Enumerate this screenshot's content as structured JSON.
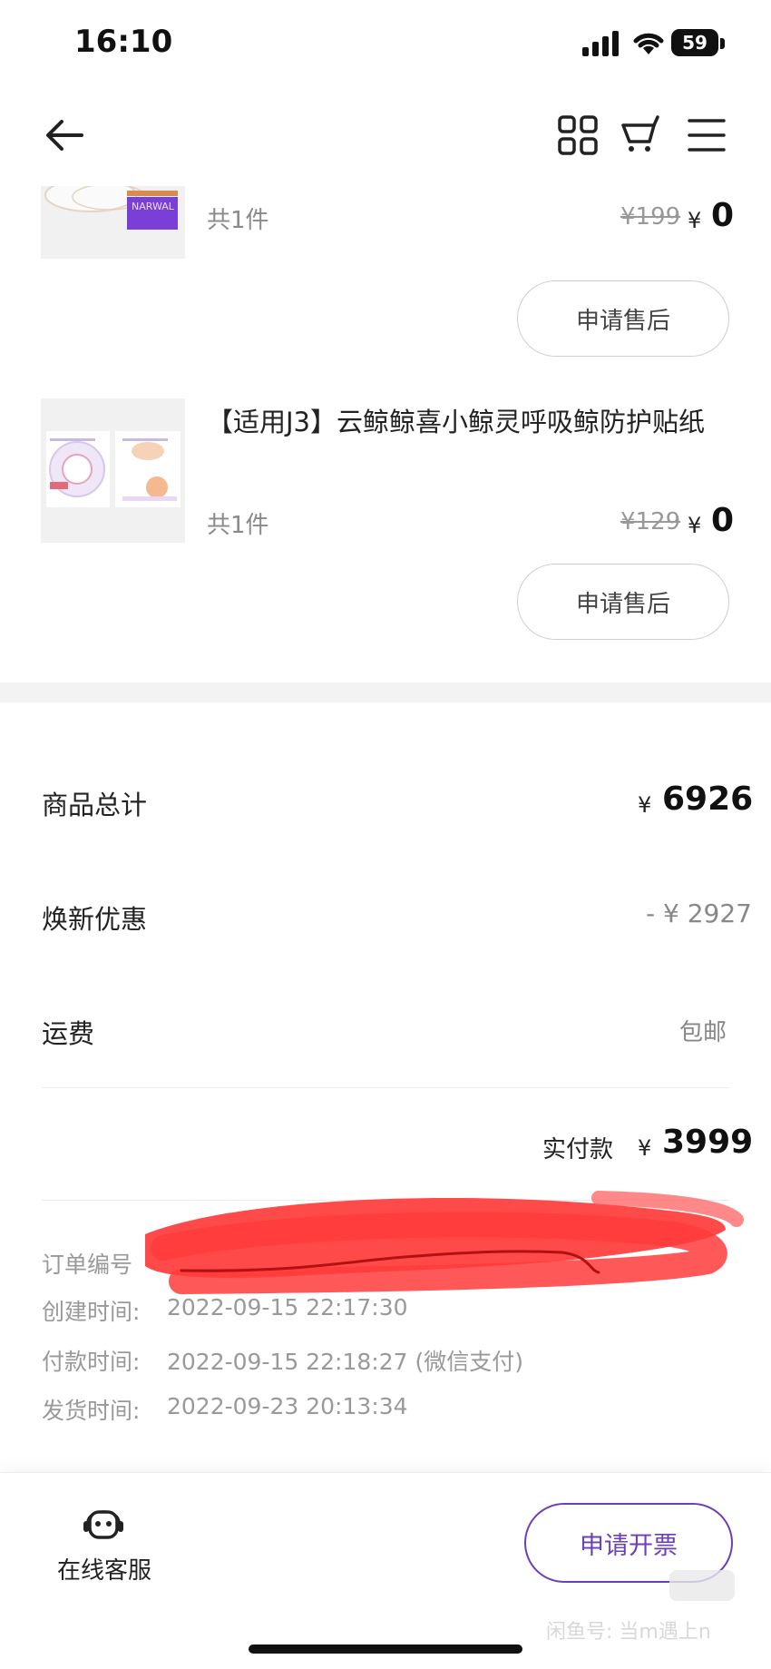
{
  "status": {
    "time": "16:10",
    "battery": "59"
  },
  "nav": {
    "icons": [
      "back-arrow-icon",
      "grid-icon",
      "cart-icon",
      "menu-icon"
    ]
  },
  "items": [
    {
      "thumb_text": "NARWAL",
      "count": "共1件",
      "orig_price": "¥199",
      "yen": "¥",
      "price": "0",
      "action": "申请售后"
    },
    {
      "title": "【适用J3】云鲸鲸喜小鲸灵呼吸鲸防护贴纸",
      "count": "共1件",
      "orig_price": "¥129",
      "yen": "¥",
      "price": "0",
      "action": "申请售后"
    }
  ],
  "summary": {
    "goods_total_label": "商品总计",
    "goods_total_yen": "¥",
    "goods_total": "6926",
    "discount_label": "焕新优惠",
    "discount": "- ¥ 2927",
    "shipping_label": "运费",
    "shipping": "包邮",
    "paid_label": "实付款",
    "paid_yen": "¥",
    "paid": "3999"
  },
  "order_info": {
    "order_no_label": "订单编号",
    "created_label": "创建时间:",
    "created": "2022-09-15 22:17:30",
    "paid_label": "付款时间:",
    "paid": "2022-09-15 22:18:27 (微信支付)",
    "shipped_label": "发货时间:",
    "shipped": "2022-09-23 20:13:34"
  },
  "bottom": {
    "service_label": "在线客服",
    "invoice_label": "申请开票"
  },
  "watermark": "闲鱼号: 当m遇上n",
  "colors": {
    "accent": "#6b3fb8",
    "scribble": "#ff3b3b"
  }
}
